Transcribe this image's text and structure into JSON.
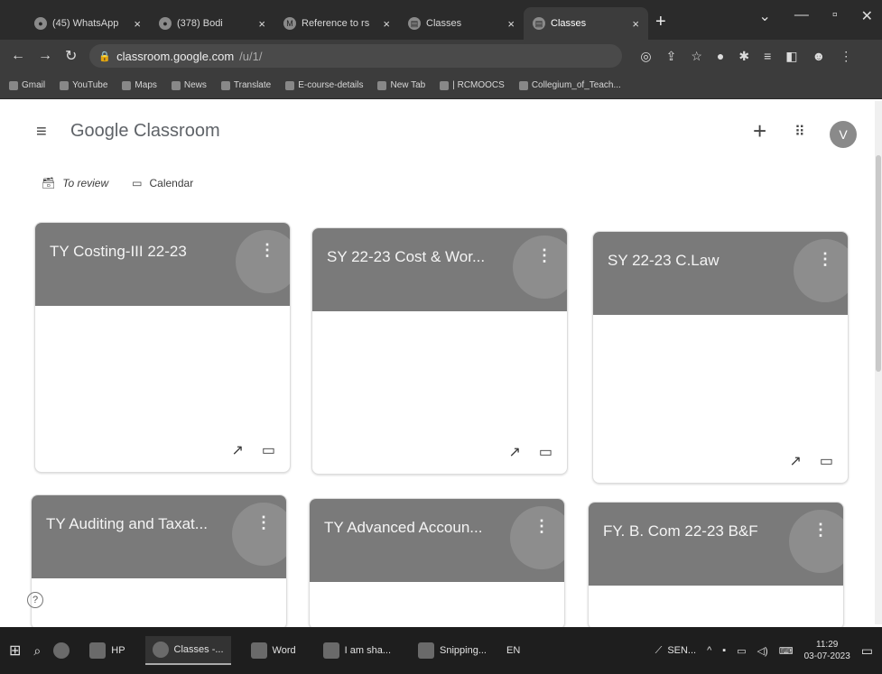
{
  "browser": {
    "tabs": [
      {
        "label": "(45) WhatsApp",
        "icon": "whatsapp-icon",
        "active": false
      },
      {
        "label": "(378) Bodi",
        "icon": "tab-icon",
        "active": false
      },
      {
        "label": "Reference to rs",
        "icon": "gmail-icon",
        "active": false
      },
      {
        "label": "Classes",
        "icon": "classroom-icon",
        "active": false
      },
      {
        "label": "Classes",
        "icon": "classroom-icon",
        "active": true
      }
    ],
    "new_tab": "+",
    "url": "classroom.google.com",
    "url_path": "/u/1/",
    "bookmarks": [
      "Gmail",
      "YouTube",
      "Maps",
      "News",
      "Translate",
      "E-course-details",
      "New Tab",
      "| RCMOOCS",
      "Collegium_of_Teach..."
    ]
  },
  "classroom": {
    "app_name": "Google Classroom",
    "avatar_letter": "V",
    "links": {
      "review": "To review",
      "calendar": "Calendar"
    },
    "cards": [
      {
        "title": "TY Costing-III 22-23"
      },
      {
        "title": "SY 22-23 Cost & Wor..."
      },
      {
        "title": "SY 22-23 C.Law"
      },
      {
        "title": "TY Auditing and Taxat..."
      },
      {
        "title": "TY Advanced Accoun..."
      },
      {
        "title": "FY. B. Com 22-23 B&F"
      }
    ]
  },
  "taskbar": {
    "apps": [
      "HP",
      "Classes -...",
      "Word",
      "I am sha...",
      "Snipping..."
    ],
    "lang": "EN",
    "sensex": "SEN...",
    "time": "11:29",
    "date": "03-07-2023"
  }
}
